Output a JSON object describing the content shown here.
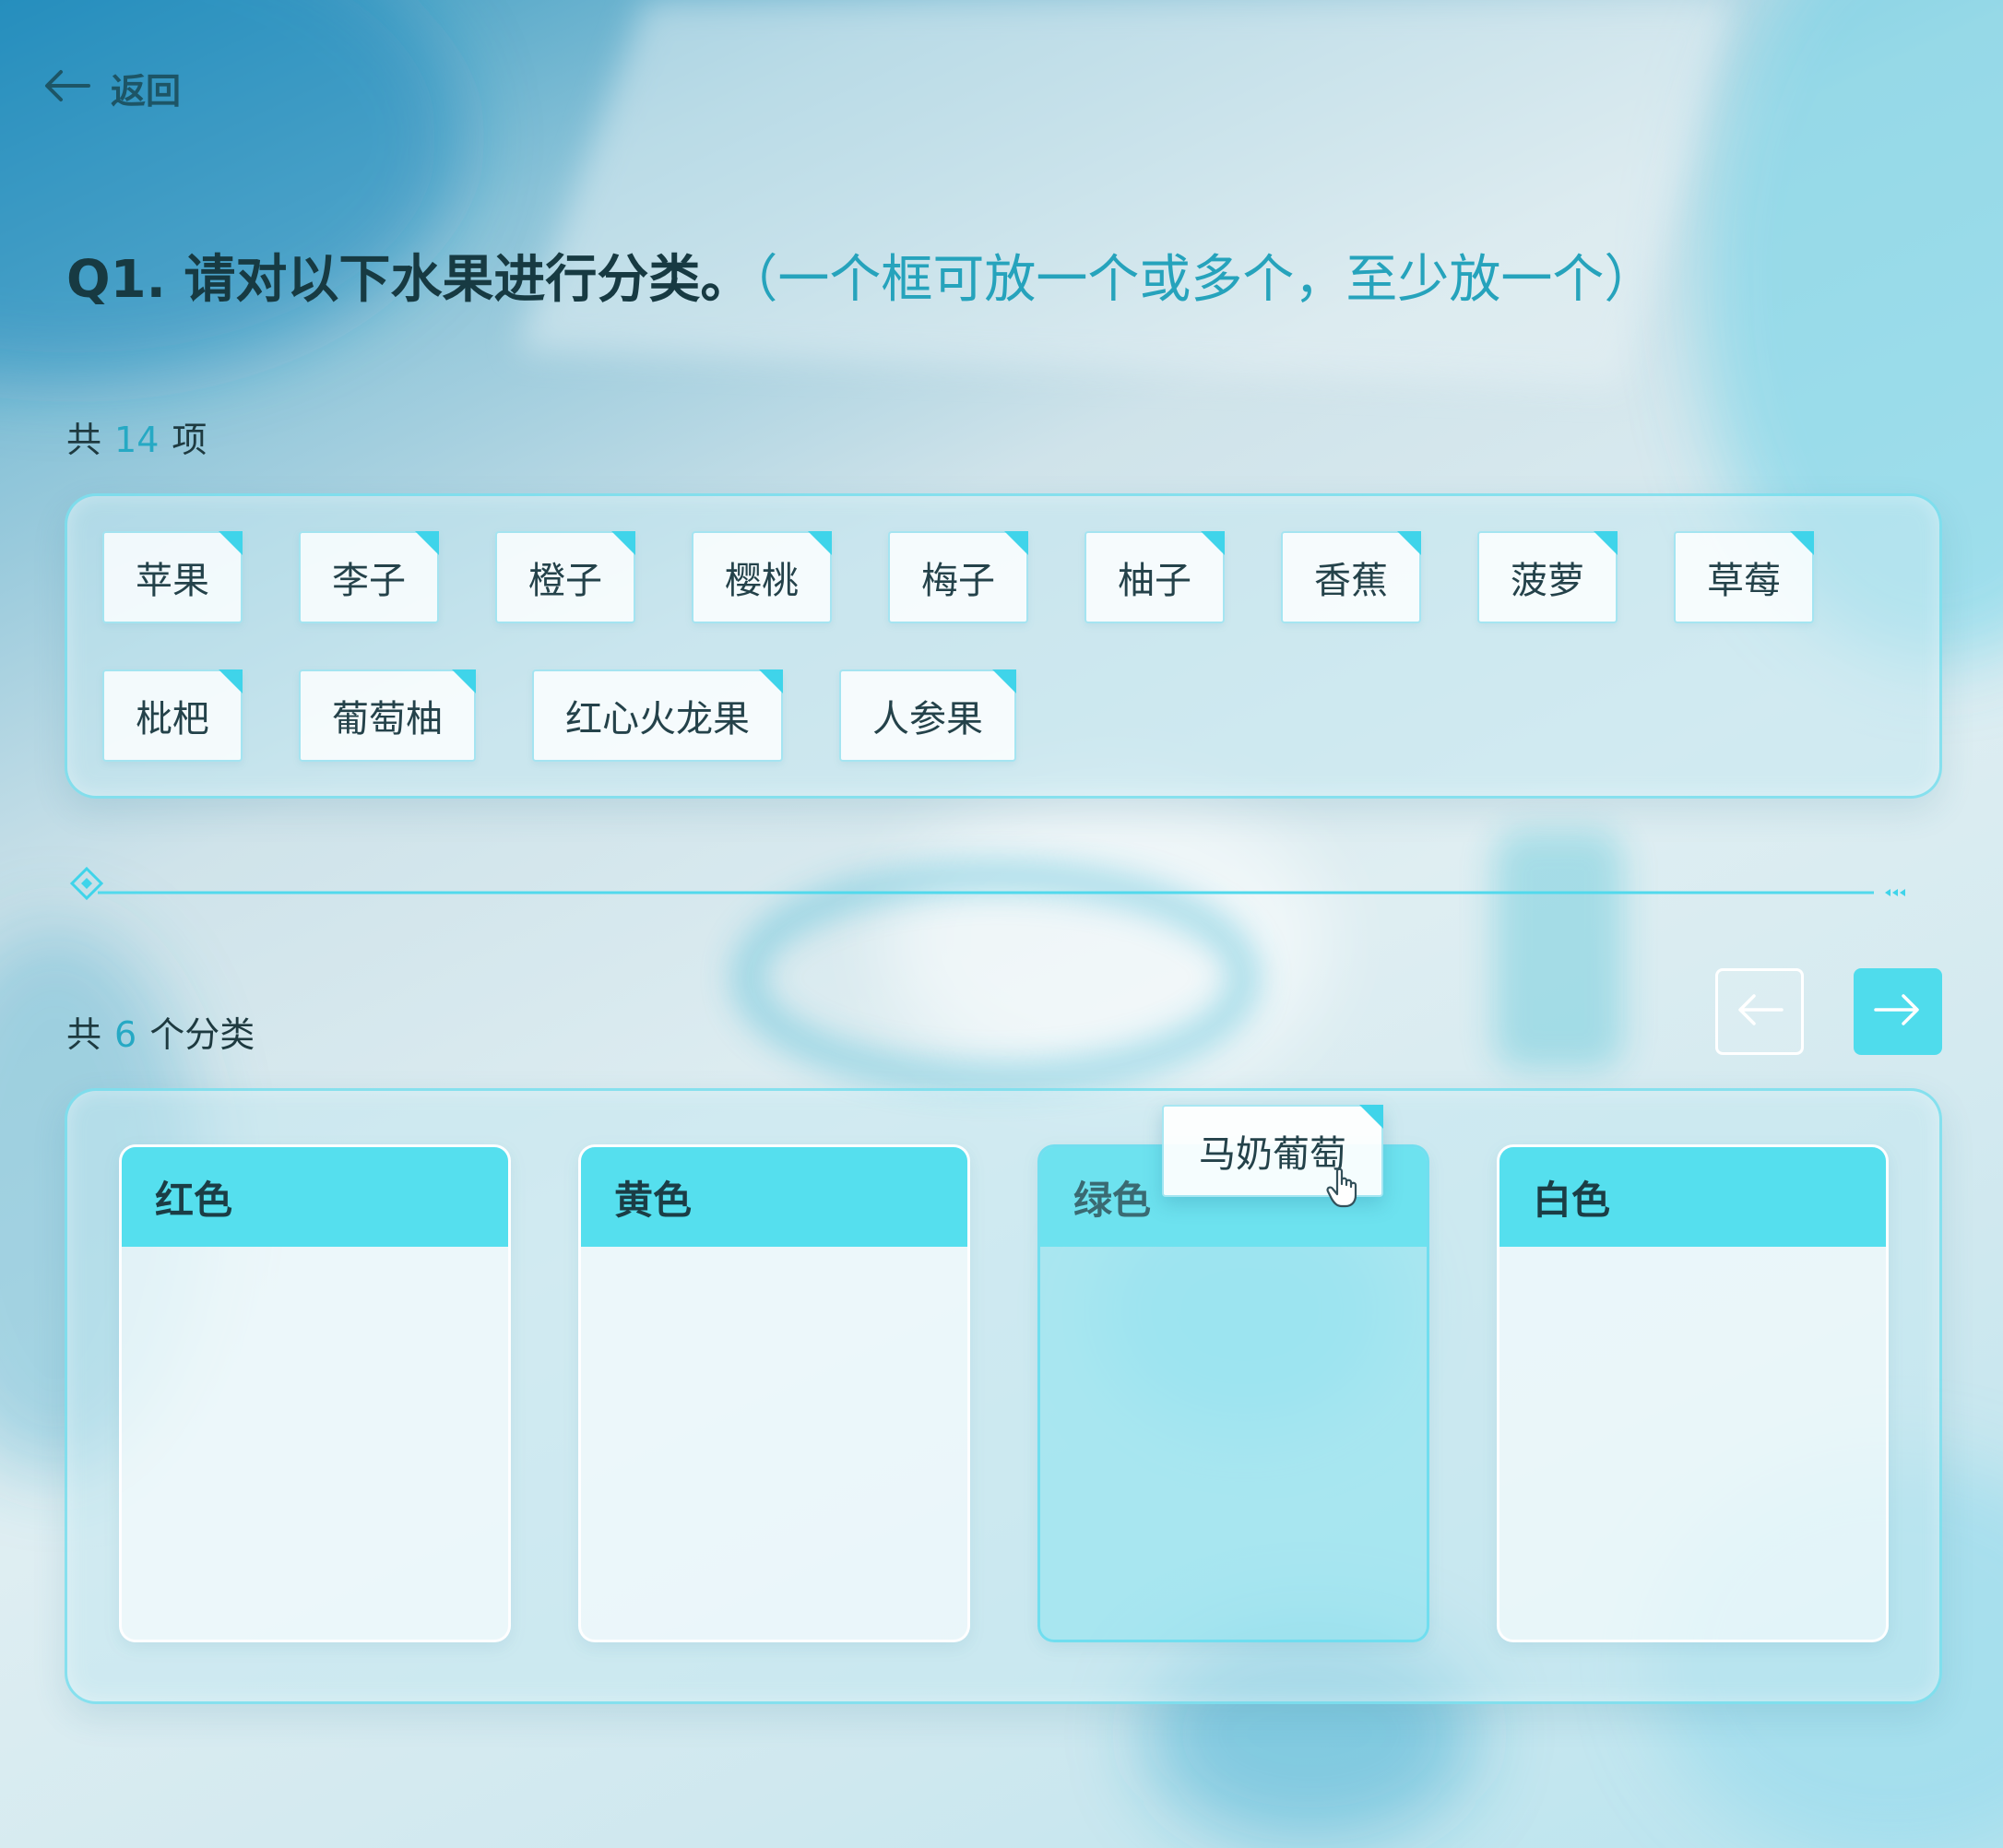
{
  "nav": {
    "back_label": "返回"
  },
  "question": {
    "title": "Q1. 请对以下水果进行分类。",
    "hint": "（一个框可放一个或多个，至少放一个）"
  },
  "items_count": {
    "prefix": "共",
    "count": "14",
    "suffix": "项"
  },
  "items": [
    "苹果",
    "李子",
    "橙子",
    "樱桃",
    "梅子",
    "柚子",
    "香蕉",
    "菠萝",
    "草莓",
    "枇杷",
    "葡萄柚",
    "红心火龙果",
    "人参果"
  ],
  "categories_count": {
    "prefix": "共",
    "count": "6",
    "suffix": "个分类"
  },
  "categories": [
    "红色",
    "黄色",
    "绿色",
    "白色"
  ],
  "dragging_item": "马奶葡萄",
  "colors": {
    "accent": "#4fdcec",
    "accent_text": "#26a3bc",
    "title": "#173a42"
  },
  "icons": {
    "back": "arrow-left-icon",
    "prev": "arrow-left-icon",
    "next": "arrow-right-icon",
    "cursor": "hand-pointer-icon"
  }
}
